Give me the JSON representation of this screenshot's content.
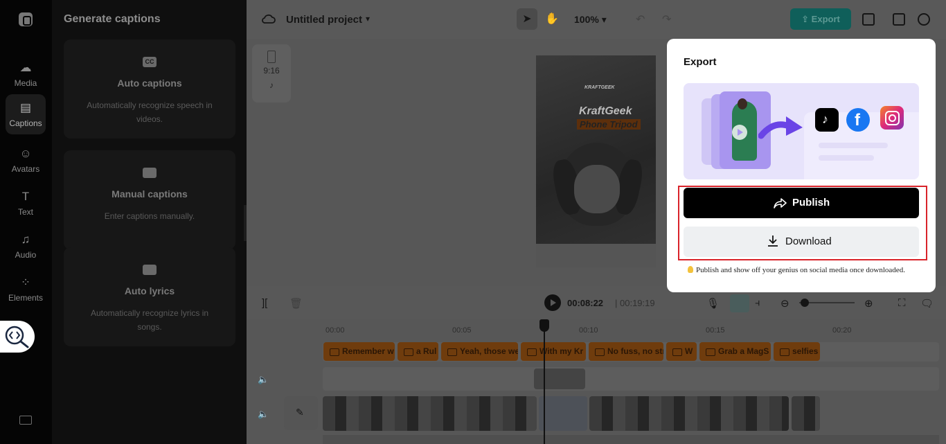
{
  "sidebar": {
    "items": [
      {
        "label": "Media",
        "icon": "cloud-upload-icon"
      },
      {
        "label": "Captions",
        "icon": "captions-icon",
        "active": true
      },
      {
        "label": "Avatars",
        "icon": "avatar-icon"
      },
      {
        "label": "Text",
        "icon": "text-icon"
      },
      {
        "label": "Audio",
        "icon": "music-note-icon"
      },
      {
        "label": "Elements",
        "icon": "elements-icon"
      }
    ]
  },
  "panel": {
    "title": "Generate captions",
    "cards": [
      {
        "title": "Auto captions",
        "desc": "Automatically recognize speech in videos.",
        "icon": "cc-icon",
        "icon_text": "CC"
      },
      {
        "title": "Manual captions",
        "desc": "Enter captions manually.",
        "icon": "keyboard-icon"
      },
      {
        "title": "Auto lyrics",
        "desc": "Automatically recognize lyrics in songs.",
        "icon": "lyrics-icon"
      }
    ]
  },
  "topbar": {
    "project_name": "Untitled project",
    "zoom": "100%",
    "export_label": "Export"
  },
  "canvas": {
    "ratio_label": "9:16",
    "preview_brand_small": "KRAFTGEEK",
    "preview_brand": "KraftGeek",
    "preview_subtitle": "Phone Tripod"
  },
  "timeline": {
    "current_time": "00:08:22",
    "total_time": "00:19:19",
    "ruler_ticks": [
      "00:00",
      "00:05",
      "00:10",
      "00:15",
      "00:20"
    ],
    "caption_chips": [
      "Remember w",
      "a Rul",
      "Yeah, those we",
      "With my Kr",
      "No fuss, no str",
      "W",
      "Grab a MagS",
      "selfies"
    ]
  },
  "export_modal": {
    "title": "Export",
    "publish_label": "Publish",
    "download_label": "Download",
    "tip": "Publish and show off your genius on social media once downloaded."
  },
  "colors": {
    "accent": "#1eb8ad",
    "caption_chip": "#d9781a",
    "highlight": "#d9232a"
  }
}
